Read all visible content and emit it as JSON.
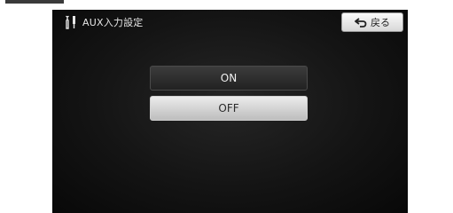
{
  "header": {
    "title": "AUX入力設定",
    "icon": "wrench-screwdriver-icon"
  },
  "back_button": {
    "label": "戻る",
    "icon": "return-arrow-icon"
  },
  "options": [
    {
      "label": "ON",
      "selected": false
    },
    {
      "label": "OFF",
      "selected": true
    }
  ]
}
